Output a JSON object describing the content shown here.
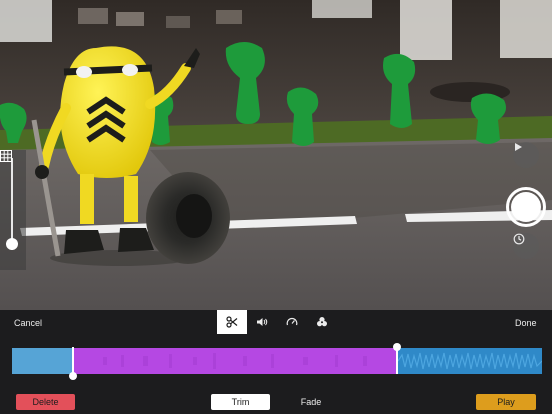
{
  "editor": {
    "cancel_label": "Cancel",
    "done_label": "Done",
    "tools": [
      {
        "icon": "scissors-icon",
        "active": true
      },
      {
        "icon": "volume-icon",
        "active": false
      },
      {
        "icon": "speed-icon",
        "active": false
      },
      {
        "icon": "effects-icon",
        "active": false
      }
    ],
    "delete_label": "Delete",
    "trim_label": "Trim",
    "fade_label": "Fade",
    "play_label": "Play"
  },
  "colors": {
    "delete": "#e3505a",
    "play": "#dd9d1d",
    "selection": "#b548e3",
    "audio": "#2f89c8"
  }
}
